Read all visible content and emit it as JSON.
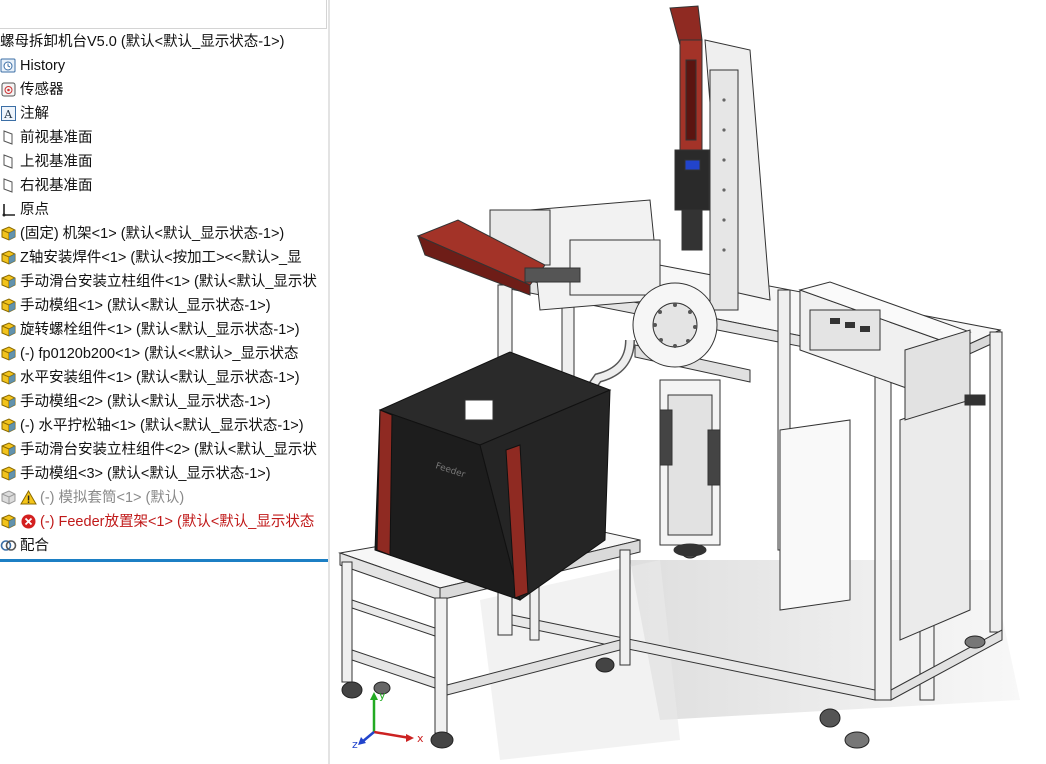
{
  "tree": {
    "root_label": "螺母拆卸机台V5.0  (默认<默认_显示状态-1>)",
    "items": [
      {
        "label": "History",
        "icon": "history-icon"
      },
      {
        "label": "传感器",
        "icon": "sensor-icon"
      },
      {
        "label": "注解",
        "icon": "annotation-icon"
      },
      {
        "label": "前视基准面",
        "icon": "plane-icon"
      },
      {
        "label": "上视基准面",
        "icon": "plane-icon"
      },
      {
        "label": "右视基准面",
        "icon": "plane-icon"
      },
      {
        "label": "原点",
        "icon": "origin-icon"
      },
      {
        "label": "(固定) 机架<1> (默认<默认_显示状态-1>)",
        "icon": "part-icon"
      },
      {
        "label": "Z轴安装焊件<1> (默认<按加工><<默认>_显",
        "icon": "part-icon"
      },
      {
        "label": "手动滑台安装立柱组件<1> (默认<默认_显示状",
        "icon": "assembly-icon"
      },
      {
        "label": "手动模组<1> (默认<默认_显示状态-1>)",
        "icon": "assembly-icon"
      },
      {
        "label": "旋转螺栓组件<1> (默认<默认_显示状态-1>)",
        "icon": "assembly-icon"
      },
      {
        "label": "(-) fp0120b200<1> (默认<<默认>_显示状态",
        "icon": "assembly-icon"
      },
      {
        "label": "水平安装组件<1> (默认<默认_显示状态-1>)",
        "icon": "assembly-icon"
      },
      {
        "label": "手动模组<2> (默认<默认_显示状态-1>)",
        "icon": "assembly-icon"
      },
      {
        "label": "(-) 水平拧松轴<1> (默认<默认_显示状态-1>)",
        "icon": "assembly-icon"
      },
      {
        "label": "手动滑台安装立柱组件<2> (默认<默认_显示状",
        "icon": "assembly-icon"
      },
      {
        "label": "手动模组<3> (默认<默认_显示状态-1>)",
        "icon": "assembly-icon"
      },
      {
        "label": "(-) 模拟套筒<1> (默认)",
        "icon": "warning-icon",
        "state": "suppressed"
      },
      {
        "label": "(-) Feeder放置架<1> (默认<默认_显示状态",
        "icon": "error-icon",
        "state": "error"
      },
      {
        "label": "配合",
        "icon": "mates-icon"
      }
    ]
  },
  "viewport": {
    "triad": {
      "x_label": "x",
      "y_label": "y",
      "z_label": "z"
    },
    "colors": {
      "frame": "#f2f2f2",
      "frame_edge": "#333333",
      "feeder_box": "#1e1e1e",
      "accent_red": "#9a2a22",
      "axis_x": "#cc2222",
      "axis_y": "#22aa22",
      "axis_z": "#2244cc"
    }
  }
}
